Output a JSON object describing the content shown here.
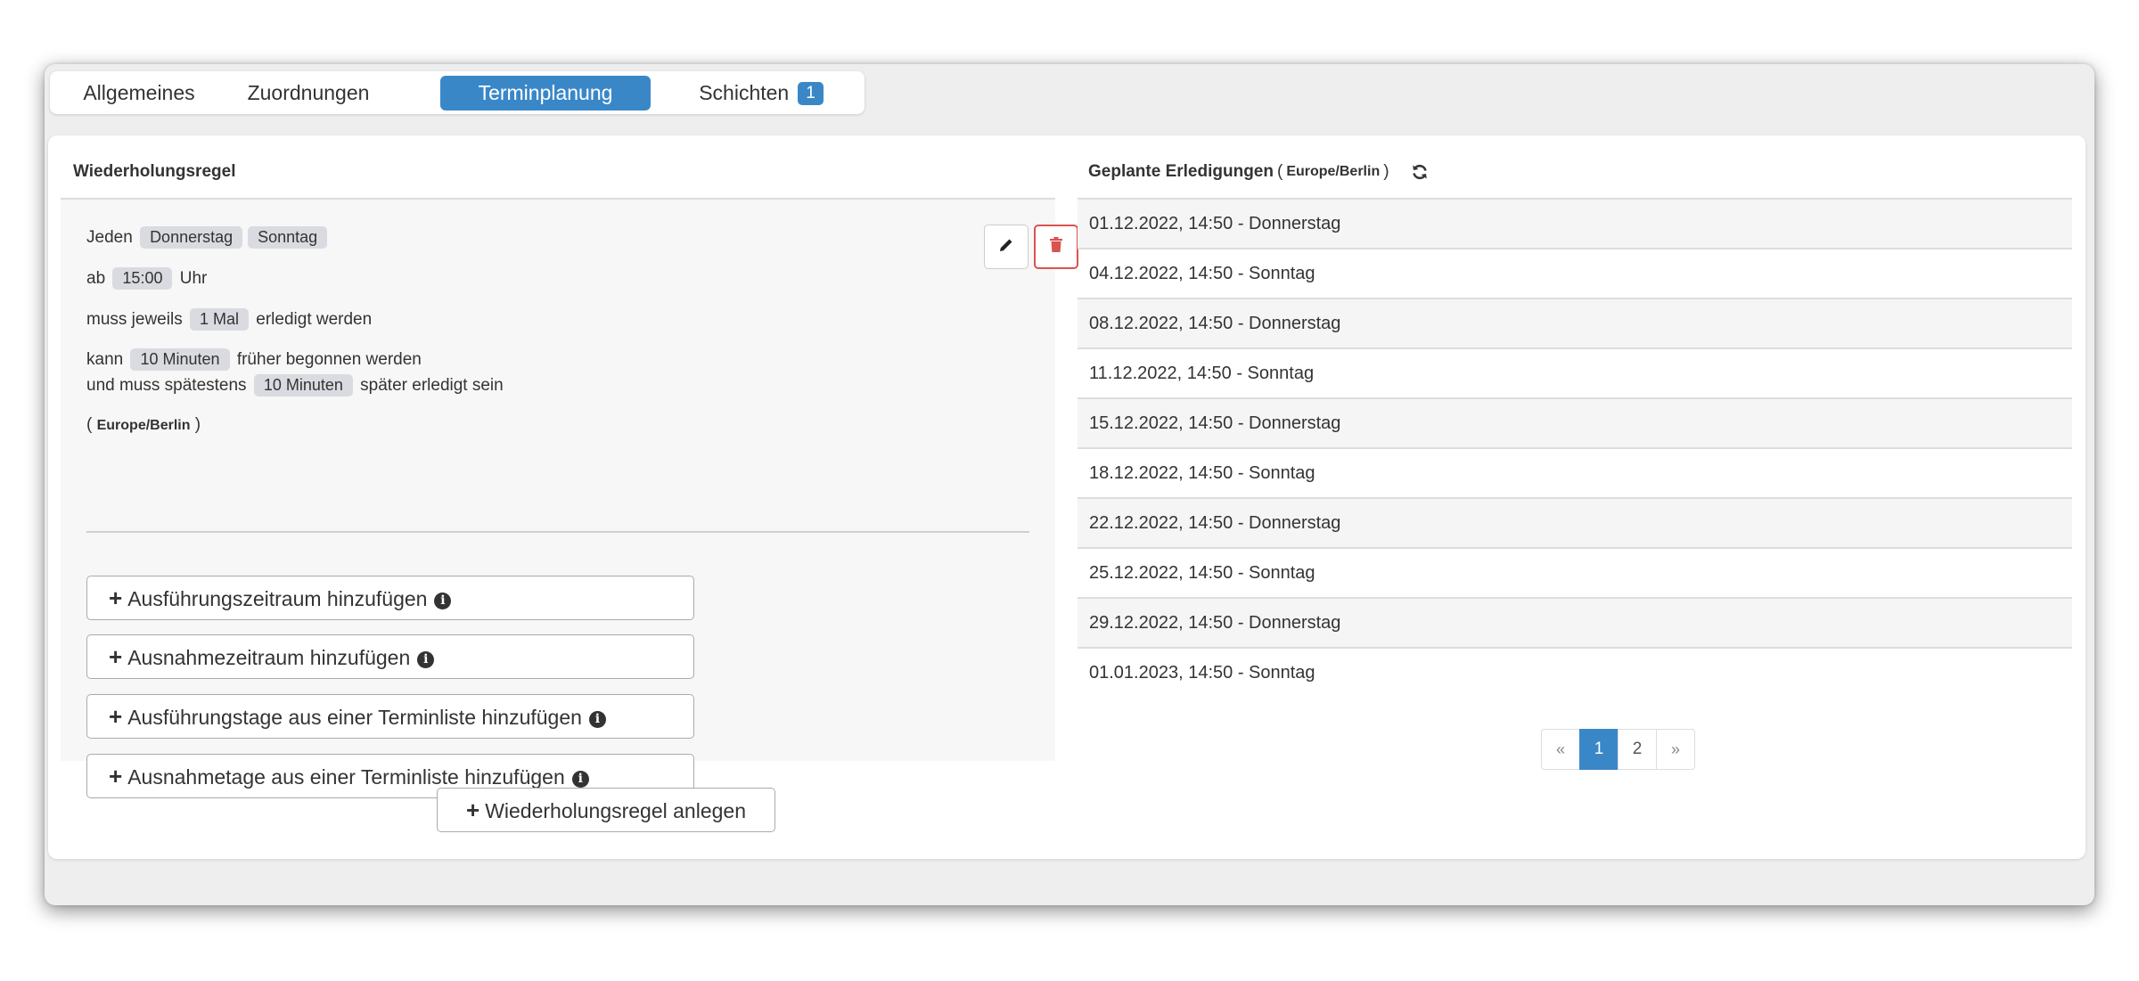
{
  "tabs": [
    {
      "label": "Allgemeines",
      "active": false
    },
    {
      "label": "Zuordnungen",
      "active": false
    },
    {
      "label": "Terminplanung",
      "active": true
    },
    {
      "label": "Schichten",
      "active": false,
      "badge": "1"
    }
  ],
  "rule": {
    "title": "Wiederholungsregel",
    "line1_prefix": "Jeden",
    "days": [
      "Donnerstag",
      "Sonntag"
    ],
    "line2_prefix": "ab",
    "time": "15:00",
    "line2_suffix": "Uhr",
    "line3_prefix": "muss jeweils",
    "times_count": "1 Mal",
    "line3_suffix": "erledigt werden",
    "line4_prefix": "kann",
    "early_minutes": "10 Minuten",
    "line4_suffix": "früher begonnen werden",
    "line5_prefix": "und muss spätestens",
    "late_minutes": "10 Minuten",
    "line5_suffix": "später erledigt sein",
    "timezone": "Europe/Berlin",
    "edit_icon": "pencil-icon",
    "delete_icon": "trash-icon"
  },
  "add_buttons": [
    {
      "label": "Ausführungszeitraum hinzufügen",
      "icon": "info-icon"
    },
    {
      "label": "Ausnahmezeitraum hinzufügen",
      "icon": "info-icon"
    },
    {
      "label": "Ausführungstage aus einer Terminliste hinzufügen",
      "icon": "info-icon"
    },
    {
      "label": "Ausnahmetage aus einer Terminliste hinzufügen",
      "icon": "info-icon"
    }
  ],
  "create_button": {
    "label": "Wiederholungsregel anlegen"
  },
  "scheduled": {
    "title": "Geplante Erledigungen",
    "timezone": "Europe/Berlin",
    "refresh_icon": "refresh-icon",
    "rows": [
      "01.12.2022, 14:50 - Donnerstag",
      "04.12.2022, 14:50 - Sonntag",
      "08.12.2022, 14:50 - Donnerstag",
      "11.12.2022, 14:50 - Sonntag",
      "15.12.2022, 14:50 - Donnerstag",
      "18.12.2022, 14:50 - Sonntag",
      "22.12.2022, 14:50 - Donnerstag",
      "25.12.2022, 14:50 - Sonntag",
      "29.12.2022, 14:50 - Donnerstag",
      "01.01.2023, 14:50 - Sonntag"
    ]
  },
  "pagination": {
    "prev": "«",
    "pages": [
      "1",
      "2"
    ],
    "current": "1",
    "next": "»"
  },
  "colors": {
    "accent": "#3a87c8",
    "danger": "#d9534f"
  }
}
